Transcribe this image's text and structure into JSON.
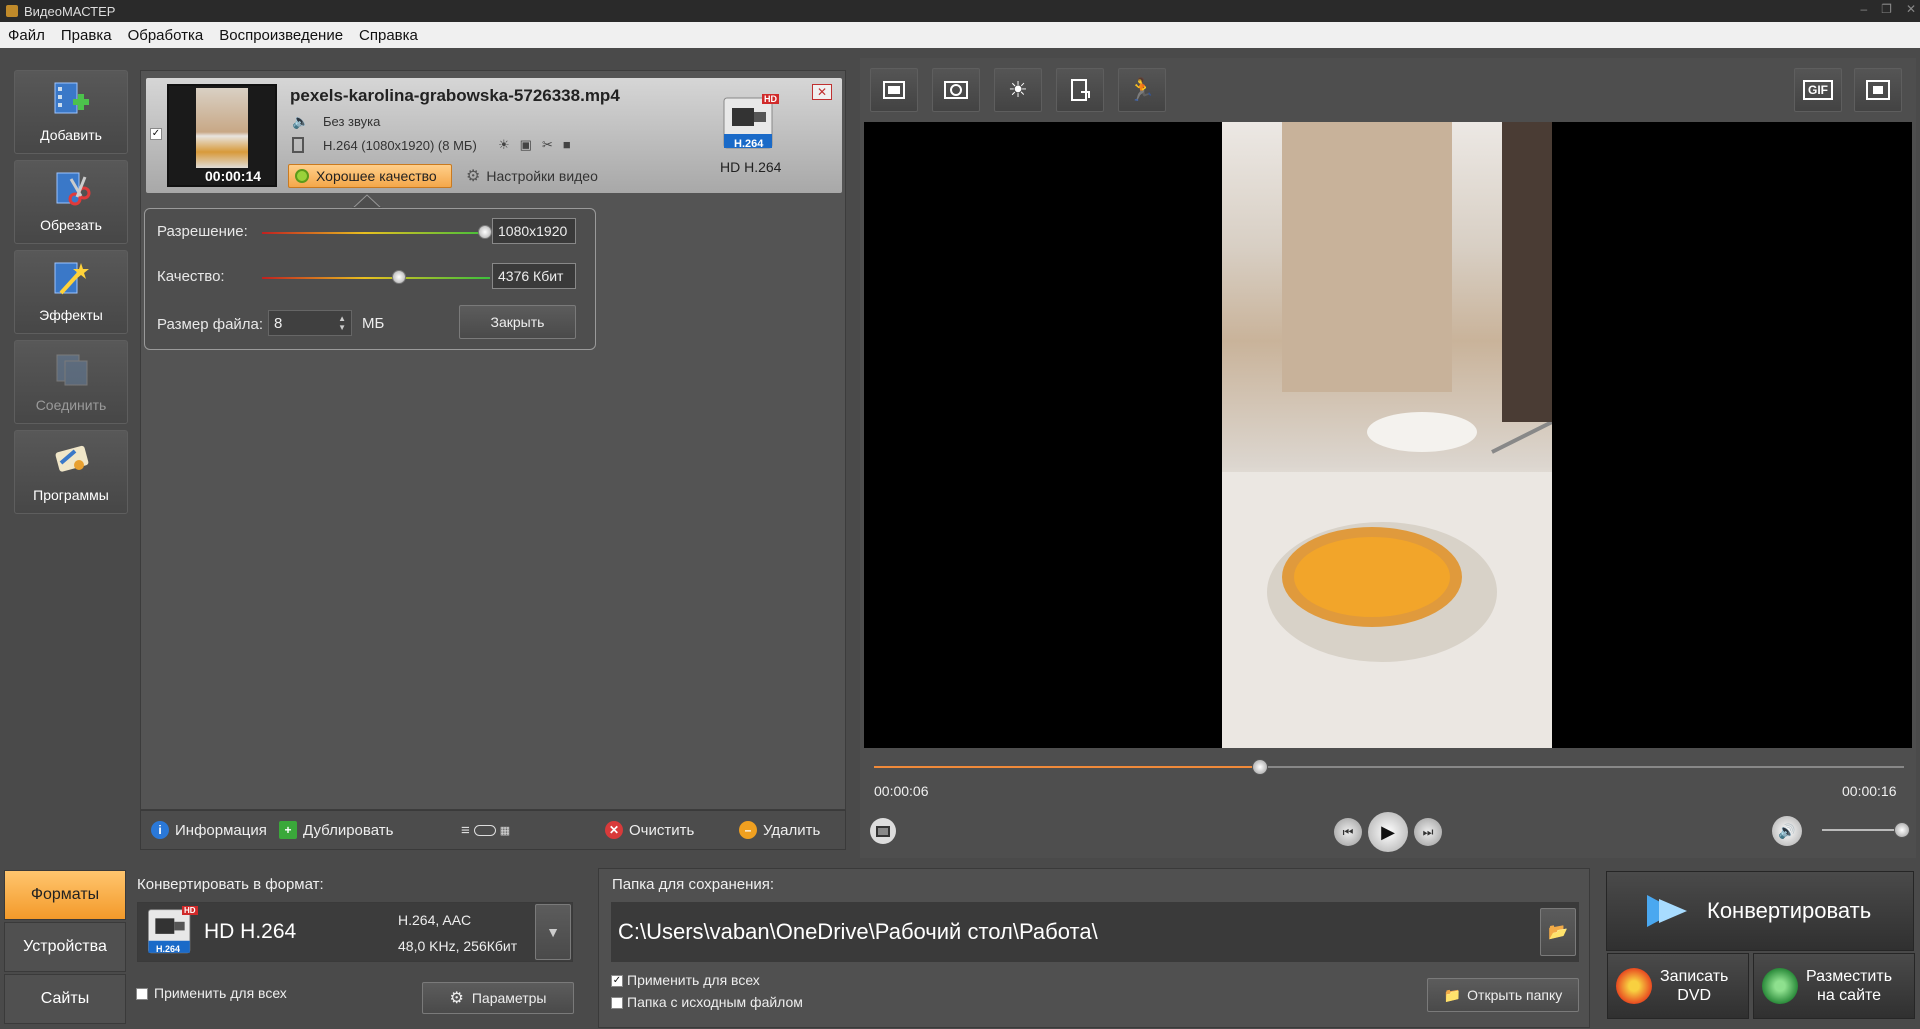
{
  "window": {
    "title": "ВидеоМАСТЕР",
    "controls": [
      "–",
      "❐",
      "✕"
    ]
  },
  "menu": [
    "Файл",
    "Правка",
    "Обработка",
    "Воспроизведение",
    "Справка"
  ],
  "sidebar": [
    {
      "label": "Добавить",
      "icon": "add-film-icon",
      "enabled": true
    },
    {
      "label": "Обрезать",
      "icon": "cut-film-icon",
      "enabled": true
    },
    {
      "label": "Эффекты",
      "icon": "magic-wand-icon",
      "enabled": true
    },
    {
      "label": "Соединить",
      "icon": "join-films-icon",
      "enabled": false
    },
    {
      "label": "Программы",
      "icon": "programs-icon",
      "enabled": true
    }
  ],
  "file": {
    "name": "pexels-karolina-grabowska-5726338.mp4",
    "duration": "00:00:14",
    "audio": "Без звука",
    "codec": "H.264 (1080x1920) (8 МБ)",
    "quality_label": "Хорошее качество",
    "settings_label": "Настройки видео",
    "format_label": "HD H.264",
    "format_badge": "H.264",
    "hd_badge": "HD",
    "checked": true
  },
  "popup": {
    "resolution_label": "Разрешение:",
    "resolution_value": "1080x1920",
    "resolution_level": 0.98,
    "quality_label": "Качество:",
    "quality_value": "4376 Кбит",
    "quality_level": 0.6,
    "size_label": "Размер файла:",
    "size_value": "8",
    "size_unit": "МБ",
    "close_label": "Закрыть"
  },
  "listtoolbar": {
    "info": "Информация",
    "duplicate": "Дублировать",
    "clear": "Очистить",
    "delete": "Удалить"
  },
  "player": {
    "current_time": "00:00:06",
    "total_time": "00:00:16",
    "progress": 0.375,
    "volume": 1.0,
    "gif_label": "GIF"
  },
  "bottom": {
    "tabs": [
      "Форматы",
      "Устройства",
      "Сайты"
    ],
    "active_tab": 0,
    "convert_to_label": "Конвертировать в формат:",
    "format_name": "HD H.264",
    "format_badge": "H.264",
    "hd_badge": "HD",
    "format_codec": "H.264, AAC",
    "format_audio": "48,0 KHz, 256Кбит",
    "apply_all": "Применить для всех",
    "params_label": "Параметры",
    "save_folder_label": "Папка для сохранения:",
    "save_path": "C:\\Users\\vaban\\OneDrive\\Рабочий стол\\Работа\\",
    "apply_all_2": "Применить для всех",
    "source_folder": "Папка с исходным файлом",
    "open_folder": "Открыть папку",
    "convert": "Конвертировать",
    "burn_dvd": "Записать\nDVD",
    "publish": "Разместить\nна сайте"
  },
  "colors": {
    "accent": "#f39a2a",
    "progress": "#f08a3a",
    "background": "#4a4a4a"
  }
}
